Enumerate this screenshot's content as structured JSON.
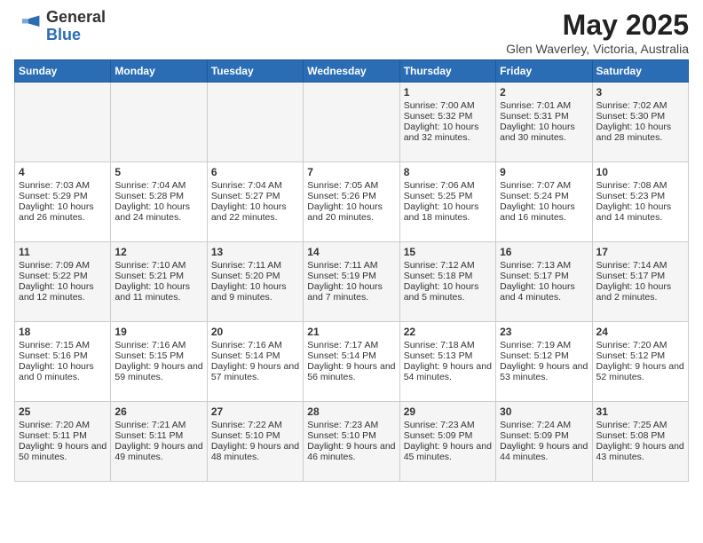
{
  "logo": {
    "general": "General",
    "blue": "Blue"
  },
  "title": "May 2025",
  "subtitle": "Glen Waverley, Victoria, Australia",
  "days_of_week": [
    "Sunday",
    "Monday",
    "Tuesday",
    "Wednesday",
    "Thursday",
    "Friday",
    "Saturday"
  ],
  "weeks": [
    [
      {
        "day": "",
        "sunrise": "",
        "sunset": "",
        "daylight": ""
      },
      {
        "day": "",
        "sunrise": "",
        "sunset": "",
        "daylight": ""
      },
      {
        "day": "",
        "sunrise": "",
        "sunset": "",
        "daylight": ""
      },
      {
        "day": "",
        "sunrise": "",
        "sunset": "",
        "daylight": ""
      },
      {
        "day": "1",
        "sunrise": "Sunrise: 7:00 AM",
        "sunset": "Sunset: 5:32 PM",
        "daylight": "Daylight: 10 hours and 32 minutes."
      },
      {
        "day": "2",
        "sunrise": "Sunrise: 7:01 AM",
        "sunset": "Sunset: 5:31 PM",
        "daylight": "Daylight: 10 hours and 30 minutes."
      },
      {
        "day": "3",
        "sunrise": "Sunrise: 7:02 AM",
        "sunset": "Sunset: 5:30 PM",
        "daylight": "Daylight: 10 hours and 28 minutes."
      }
    ],
    [
      {
        "day": "4",
        "sunrise": "Sunrise: 7:03 AM",
        "sunset": "Sunset: 5:29 PM",
        "daylight": "Daylight: 10 hours and 26 minutes."
      },
      {
        "day": "5",
        "sunrise": "Sunrise: 7:04 AM",
        "sunset": "Sunset: 5:28 PM",
        "daylight": "Daylight: 10 hours and 24 minutes."
      },
      {
        "day": "6",
        "sunrise": "Sunrise: 7:04 AM",
        "sunset": "Sunset: 5:27 PM",
        "daylight": "Daylight: 10 hours and 22 minutes."
      },
      {
        "day": "7",
        "sunrise": "Sunrise: 7:05 AM",
        "sunset": "Sunset: 5:26 PM",
        "daylight": "Daylight: 10 hours and 20 minutes."
      },
      {
        "day": "8",
        "sunrise": "Sunrise: 7:06 AM",
        "sunset": "Sunset: 5:25 PM",
        "daylight": "Daylight: 10 hours and 18 minutes."
      },
      {
        "day": "9",
        "sunrise": "Sunrise: 7:07 AM",
        "sunset": "Sunset: 5:24 PM",
        "daylight": "Daylight: 10 hours and 16 minutes."
      },
      {
        "day": "10",
        "sunrise": "Sunrise: 7:08 AM",
        "sunset": "Sunset: 5:23 PM",
        "daylight": "Daylight: 10 hours and 14 minutes."
      }
    ],
    [
      {
        "day": "11",
        "sunrise": "Sunrise: 7:09 AM",
        "sunset": "Sunset: 5:22 PM",
        "daylight": "Daylight: 10 hours and 12 minutes."
      },
      {
        "day": "12",
        "sunrise": "Sunrise: 7:10 AM",
        "sunset": "Sunset: 5:21 PM",
        "daylight": "Daylight: 10 hours and 11 minutes."
      },
      {
        "day": "13",
        "sunrise": "Sunrise: 7:11 AM",
        "sunset": "Sunset: 5:20 PM",
        "daylight": "Daylight: 10 hours and 9 minutes."
      },
      {
        "day": "14",
        "sunrise": "Sunrise: 7:11 AM",
        "sunset": "Sunset: 5:19 PM",
        "daylight": "Daylight: 10 hours and 7 minutes."
      },
      {
        "day": "15",
        "sunrise": "Sunrise: 7:12 AM",
        "sunset": "Sunset: 5:18 PM",
        "daylight": "Daylight: 10 hours and 5 minutes."
      },
      {
        "day": "16",
        "sunrise": "Sunrise: 7:13 AM",
        "sunset": "Sunset: 5:17 PM",
        "daylight": "Daylight: 10 hours and 4 minutes."
      },
      {
        "day": "17",
        "sunrise": "Sunrise: 7:14 AM",
        "sunset": "Sunset: 5:17 PM",
        "daylight": "Daylight: 10 hours and 2 minutes."
      }
    ],
    [
      {
        "day": "18",
        "sunrise": "Sunrise: 7:15 AM",
        "sunset": "Sunset: 5:16 PM",
        "daylight": "Daylight: 10 hours and 0 minutes."
      },
      {
        "day": "19",
        "sunrise": "Sunrise: 7:16 AM",
        "sunset": "Sunset: 5:15 PM",
        "daylight": "Daylight: 9 hours and 59 minutes."
      },
      {
        "day": "20",
        "sunrise": "Sunrise: 7:16 AM",
        "sunset": "Sunset: 5:14 PM",
        "daylight": "Daylight: 9 hours and 57 minutes."
      },
      {
        "day": "21",
        "sunrise": "Sunrise: 7:17 AM",
        "sunset": "Sunset: 5:14 PM",
        "daylight": "Daylight: 9 hours and 56 minutes."
      },
      {
        "day": "22",
        "sunrise": "Sunrise: 7:18 AM",
        "sunset": "Sunset: 5:13 PM",
        "daylight": "Daylight: 9 hours and 54 minutes."
      },
      {
        "day": "23",
        "sunrise": "Sunrise: 7:19 AM",
        "sunset": "Sunset: 5:12 PM",
        "daylight": "Daylight: 9 hours and 53 minutes."
      },
      {
        "day": "24",
        "sunrise": "Sunrise: 7:20 AM",
        "sunset": "Sunset: 5:12 PM",
        "daylight": "Daylight: 9 hours and 52 minutes."
      }
    ],
    [
      {
        "day": "25",
        "sunrise": "Sunrise: 7:20 AM",
        "sunset": "Sunset: 5:11 PM",
        "daylight": "Daylight: 9 hours and 50 minutes."
      },
      {
        "day": "26",
        "sunrise": "Sunrise: 7:21 AM",
        "sunset": "Sunset: 5:11 PM",
        "daylight": "Daylight: 9 hours and 49 minutes."
      },
      {
        "day": "27",
        "sunrise": "Sunrise: 7:22 AM",
        "sunset": "Sunset: 5:10 PM",
        "daylight": "Daylight: 9 hours and 48 minutes."
      },
      {
        "day": "28",
        "sunrise": "Sunrise: 7:23 AM",
        "sunset": "Sunset: 5:10 PM",
        "daylight": "Daylight: 9 hours and 46 minutes."
      },
      {
        "day": "29",
        "sunrise": "Sunrise: 7:23 AM",
        "sunset": "Sunset: 5:09 PM",
        "daylight": "Daylight: 9 hours and 45 minutes."
      },
      {
        "day": "30",
        "sunrise": "Sunrise: 7:24 AM",
        "sunset": "Sunset: 5:09 PM",
        "daylight": "Daylight: 9 hours and 44 minutes."
      },
      {
        "day": "31",
        "sunrise": "Sunrise: 7:25 AM",
        "sunset": "Sunset: 5:08 PM",
        "daylight": "Daylight: 9 hours and 43 minutes."
      }
    ]
  ]
}
